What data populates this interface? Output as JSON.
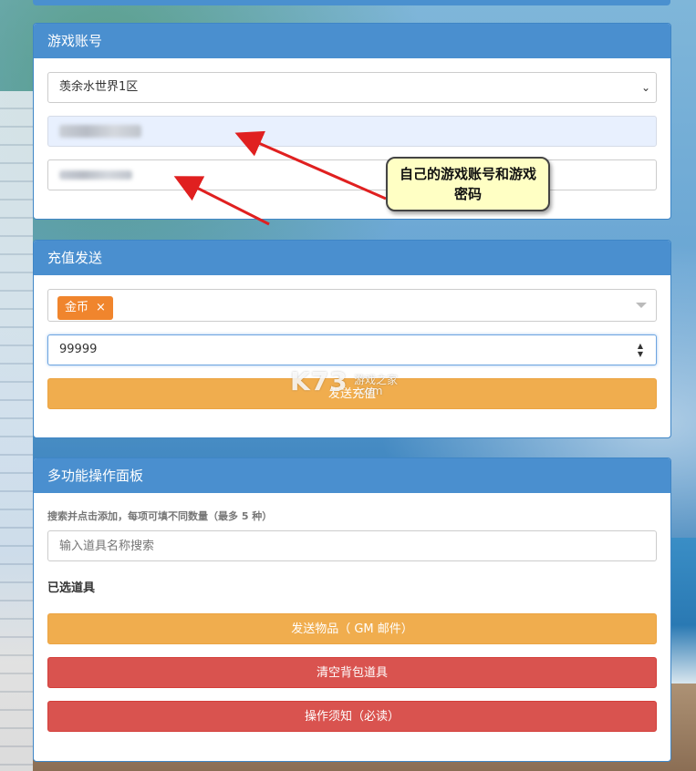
{
  "account_panel": {
    "title": "游戏账号",
    "server_select": {
      "value": "羡余水世界1区"
    },
    "account_field": {
      "value": ""
    },
    "password_field": {
      "value": ""
    }
  },
  "recharge_panel": {
    "title": "充值发送",
    "currency_tag": {
      "label": "金币",
      "remove": "×"
    },
    "amount_field": {
      "value": "99999"
    },
    "send_button": "发送充值"
  },
  "multi_panel": {
    "title": "多功能操作面板",
    "hint": "搜索并点击添加，每项可填不同数量（最多 5 种）",
    "search_field": {
      "placeholder": "输入道具名称搜索"
    },
    "selected_label": "已选道具",
    "send_items_button": "发送物品（ GM 邮件）",
    "clear_bag_button": "清空背包道具",
    "notice_button": "操作须知（必读）"
  },
  "annotation": {
    "callout_text": "自己的游戏账号和游戏密码",
    "arrow_color": "#e02020"
  },
  "watermark": {
    "logo": "K73",
    "site": "游戏之家",
    "domain": ".com"
  }
}
